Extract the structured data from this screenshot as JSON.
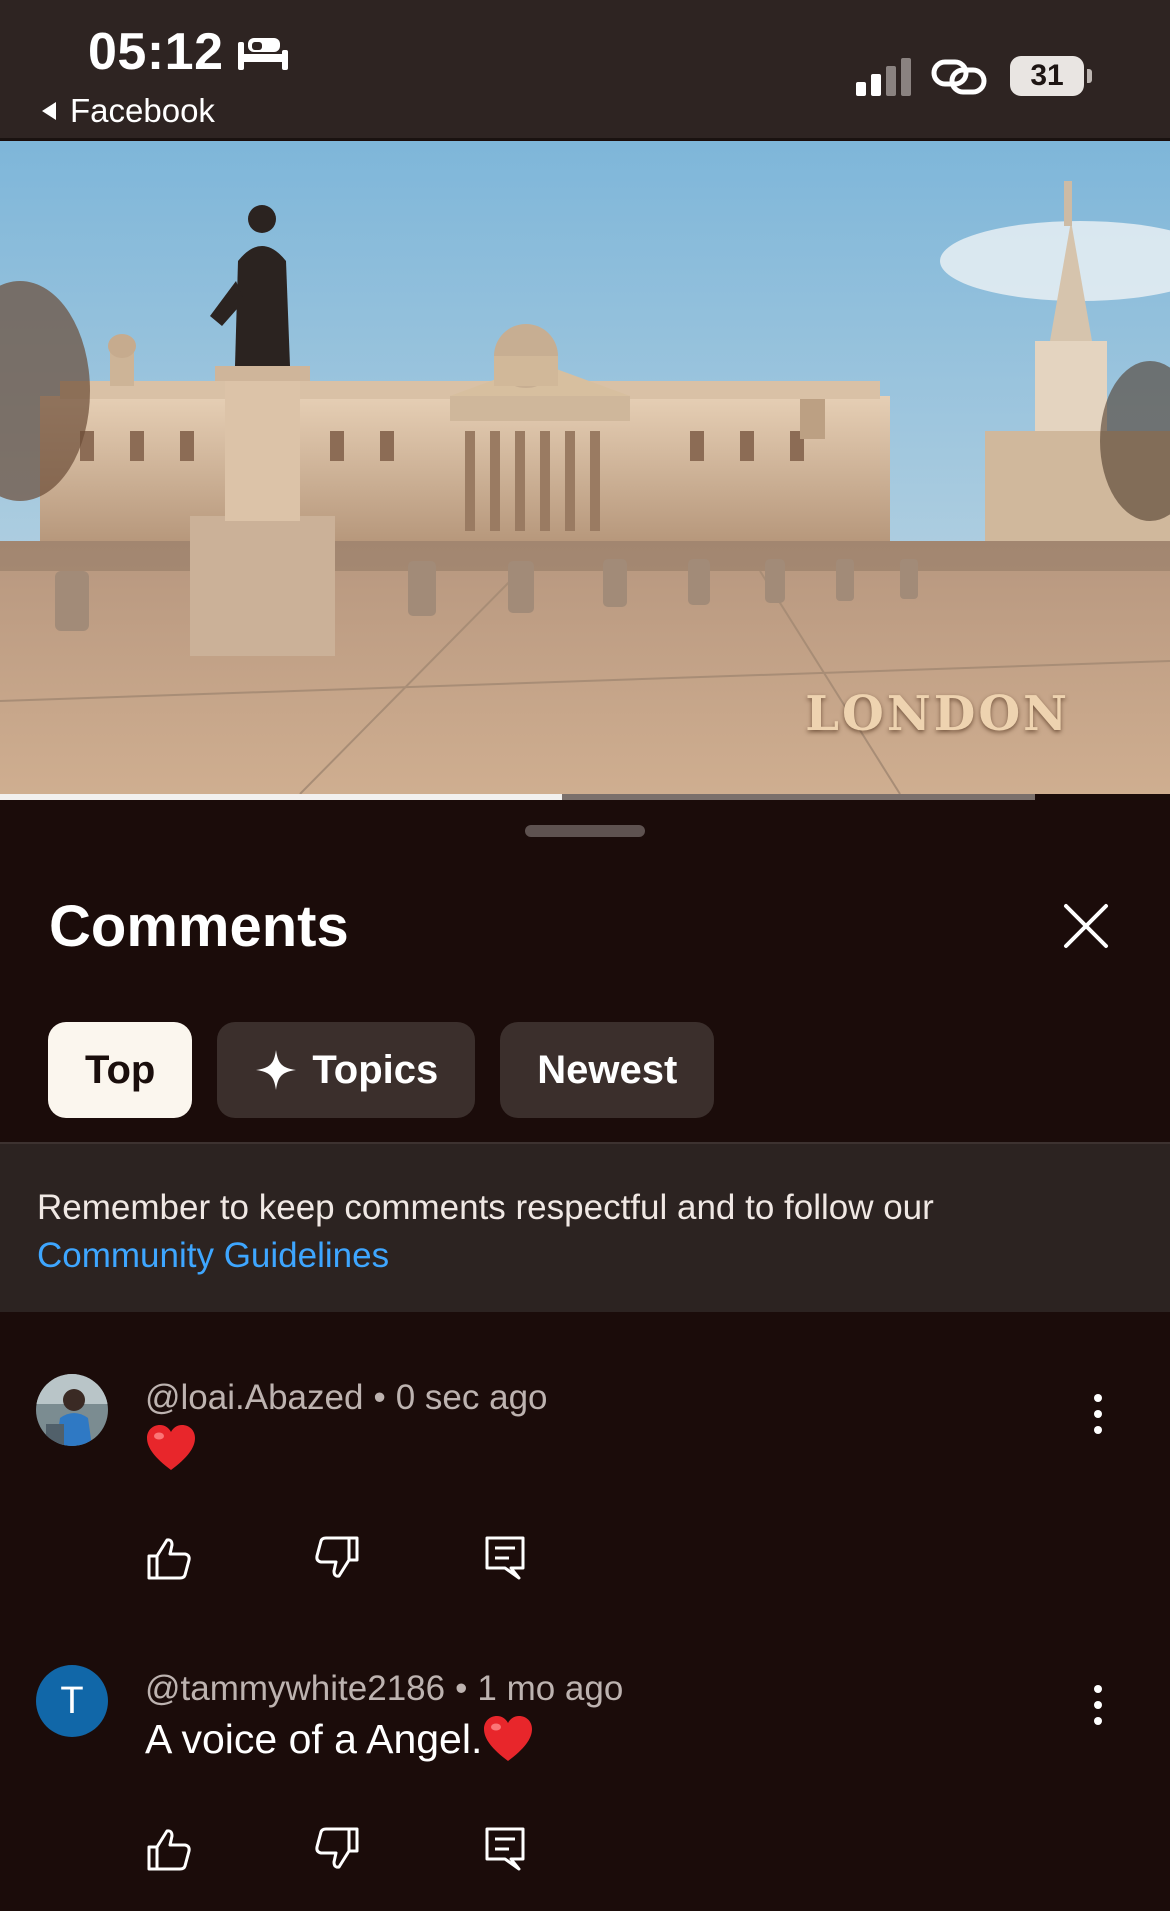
{
  "status_bar": {
    "time": "05:12",
    "back_app": "Facebook",
    "battery": "31",
    "icons": [
      "bed-icon",
      "signal-icon",
      "link-icon",
      "battery-icon"
    ]
  },
  "video": {
    "caption": "LONDON",
    "progress": 0.48,
    "buffer": 0.885
  },
  "comments_sheet": {
    "title": "Comments",
    "filters": [
      {
        "label": "Top",
        "active": true
      },
      {
        "label": "Topics",
        "icon": "sparkle-icon",
        "active": false
      },
      {
        "label": "Newest",
        "active": false
      }
    ],
    "notice": {
      "text": "Remember to keep comments respectful and to follow our",
      "link": "Community Guidelines"
    },
    "comments": [
      {
        "author": "@loai.Abazed",
        "time": "0 sec ago",
        "text": "",
        "emoji": "heart",
        "avatar": "photo"
      },
      {
        "author": "@tammywhite2186",
        "time": "1 mo ago",
        "text": "A voice of a Angel.",
        "emoji": "heart",
        "avatar_letter": "T",
        "avatar_color": "#1167a8"
      }
    ]
  },
  "colors": {
    "background": "#1b0c0a",
    "chip": "#3b2f2c",
    "chip_active": "#fbf6ee",
    "link": "#3ea6ff"
  }
}
